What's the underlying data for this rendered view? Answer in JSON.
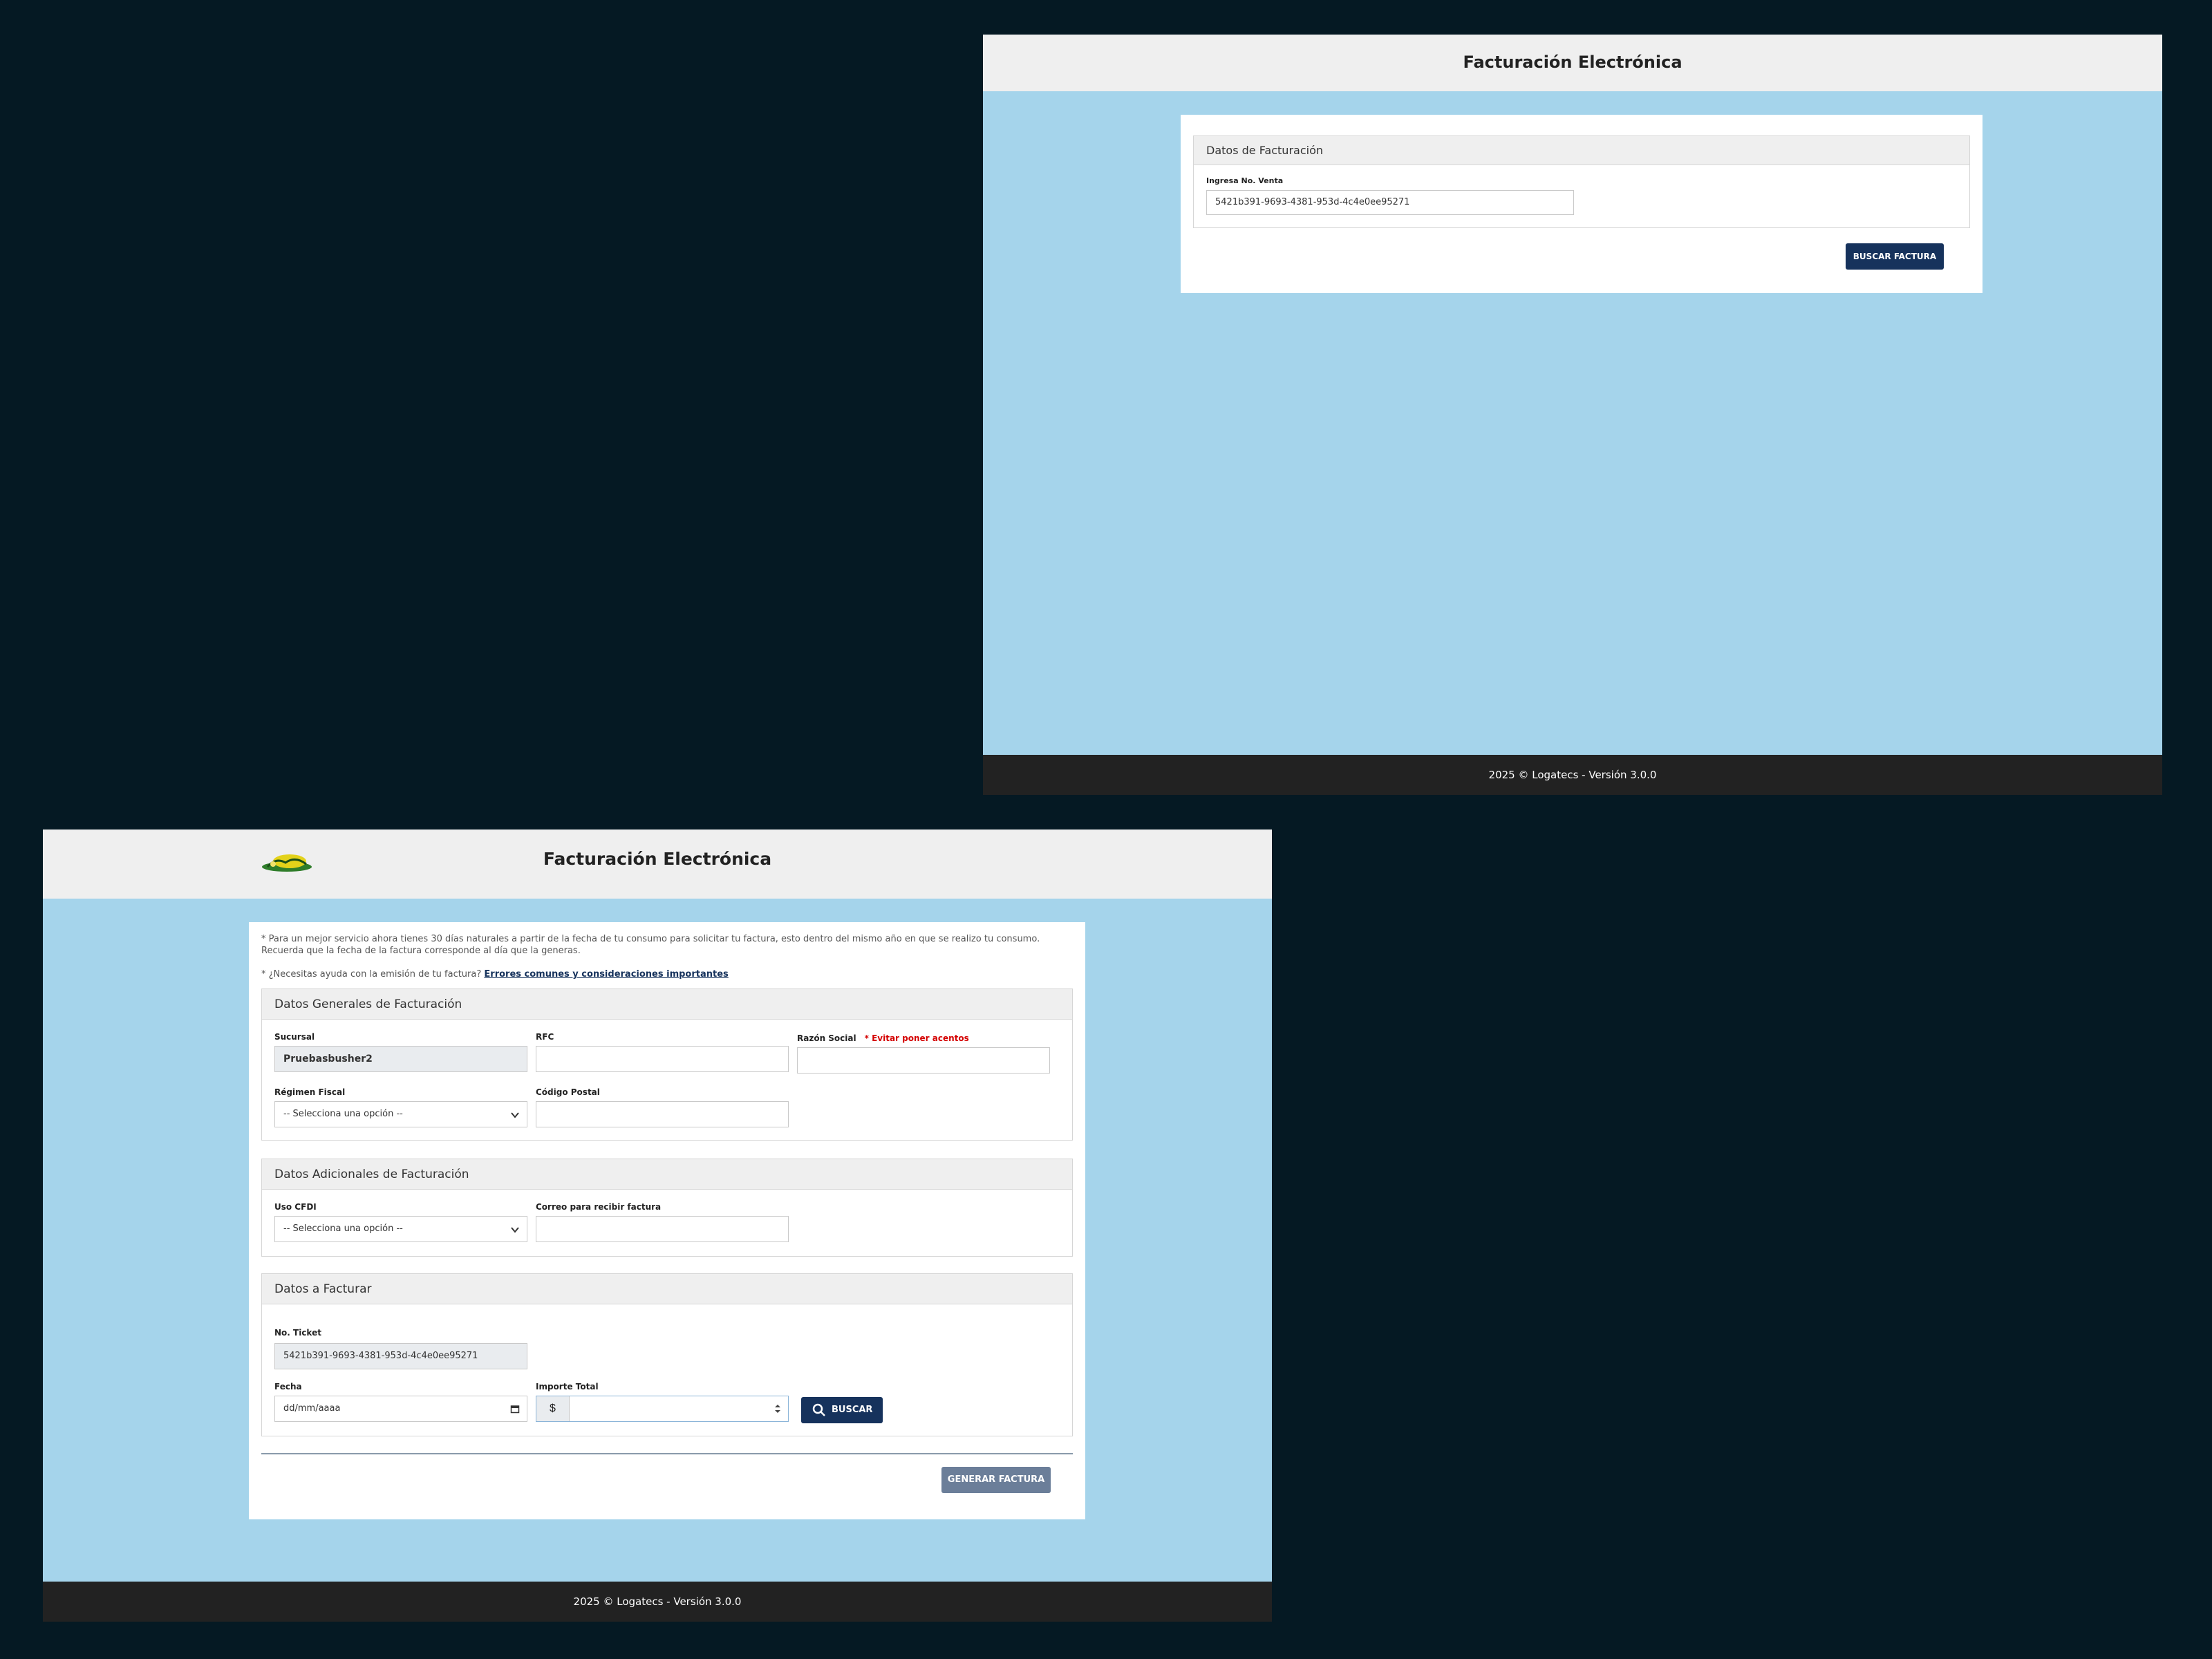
{
  "top_window": {
    "header_title": "Facturación Electrónica",
    "panel_title": "Datos de Facturación",
    "sale_label": "Ingresa No. Venta",
    "sale_value": "5421b391-9693-4381-953d-4c4e0ee95271",
    "search_button": "BUSCAR FACTURA",
    "footer": "2025 © Logatecs - Versión 3.0.0"
  },
  "bottom_window": {
    "header_title": "Facturación Electrónica",
    "notice_line1": "* Para un mejor servicio ahora tienes 30 días naturales a partir de la fecha de tu consumo para solicitar tu factura, esto dentro del mismo año en que se realizo tu consumo.",
    "notice_line2": "Recuerda que la fecha de la factura corresponde al día que la generas.",
    "help_text": "* ¿Necesitas ayuda con la emisión de tu factura?",
    "help_link": "Errores comunes y consideraciones importantes",
    "general": {
      "title": "Datos Generales de Facturación",
      "sucursal_label": "Sucursal",
      "sucursal_value": "Pruebasbusher2",
      "rfc_label": "RFC",
      "razon_label": "Razón Social",
      "razon_warning": "* Evitar poner acentos",
      "regimen_label": "Régimen Fiscal",
      "regimen_value": "-- Selecciona una opción --",
      "cp_label": "Código Postal"
    },
    "additional": {
      "title": "Datos Adicionales de Facturación",
      "uso_label": "Uso CFDI",
      "uso_value": "-- Selecciona una opción --",
      "correo_label": "Correo para recibir factura"
    },
    "invoice": {
      "title": "Datos a Facturar",
      "ticket_label": "No. Ticket",
      "ticket_value": "5421b391-9693-4381-953d-4c4e0ee95271",
      "fecha_label": "Fecha",
      "fecha_placeholder": "dd/mm/aaaa",
      "importe_label": "Importe Total",
      "currency": "$",
      "search_button": "BUSCAR"
    },
    "generate_button": "GENERAR FACTURA",
    "footer": "2025 © Logatecs - Versión 3.0.0"
  },
  "colors": {
    "background": "#051923",
    "page": "#a5d4eb",
    "header": "#efefef",
    "primary_button": "#16325c",
    "warning": "#d40000",
    "footer": "#222222"
  }
}
